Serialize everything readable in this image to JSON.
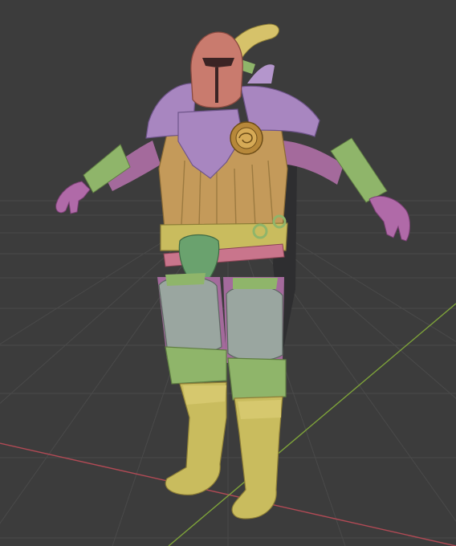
{
  "viewport": {
    "background": "#3c3c3c",
    "grid_color": "#4a4a4a",
    "axis_x_color": "#b04a55",
    "axis_y_color": "#7ea33a"
  },
  "model": {
    "subject": "armored-knight-tpose",
    "material_colors": {
      "helmet": "#c97b6e",
      "pauldron": "#a886c0",
      "tunic": "#c49a5a",
      "skin_purple": "#a46a9c",
      "bracer_green": "#8fb56a",
      "greave_grey": "#9aa6a0",
      "boot_yellow": "#c9bc5e",
      "plume": "#d6c26a",
      "belt_pink": "#c9758c"
    }
  }
}
